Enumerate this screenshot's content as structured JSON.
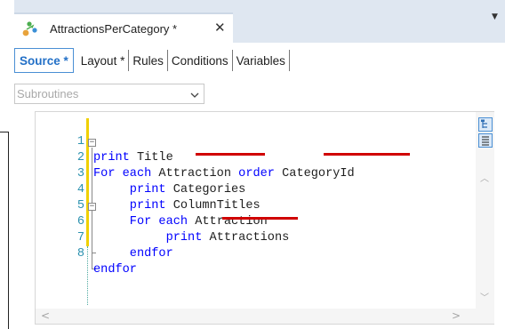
{
  "document_tab": {
    "title": "AttractionsPerCategory *",
    "close": "✕"
  },
  "tab_menu": "▼",
  "part_tabs": [
    "Source *",
    "Layout *",
    "Rules",
    "Conditions",
    "Variables"
  ],
  "subroutines": {
    "placeholder": "Subroutines",
    "chevron": "chevron-down-icon"
  },
  "code": {
    "line_numbers": [
      "1",
      "2",
      "3",
      "4",
      "5",
      "6",
      "7",
      "8"
    ],
    "lines": [
      {
        "indent": "",
        "kw1": "print",
        "rest": " Title"
      },
      {
        "indent": "",
        "kw1": "For each",
        "mid": " Attraction ",
        "kw2": "order",
        "rest": " CategoryId"
      },
      {
        "indent": "     ",
        "kw1": "print",
        "rest": " Categories"
      },
      {
        "indent": "     ",
        "kw1": "print",
        "rest": " ColumnTitles"
      },
      {
        "indent": "     ",
        "kw1": "For each",
        "rest": " Attraction"
      },
      {
        "indent": "          ",
        "kw1": "print",
        "rest": " Attractions"
      },
      {
        "indent": "     ",
        "kw1": "endfor",
        "rest": ""
      },
      {
        "indent": "",
        "kw1": "endfor",
        "rest": ""
      }
    ],
    "underlined_terms": [
      "Attraction",
      "CategoryId",
      "Attraction"
    ]
  },
  "colors": {
    "keyword": "#0000ff",
    "line_number": "#2b91af",
    "underline": "#d00000",
    "active_tab": "#2370c7",
    "modified_bar": "#f0d000"
  },
  "scrollbar": {
    "up": "︿",
    "down": "﹀",
    "left": "<",
    "right": ">"
  }
}
